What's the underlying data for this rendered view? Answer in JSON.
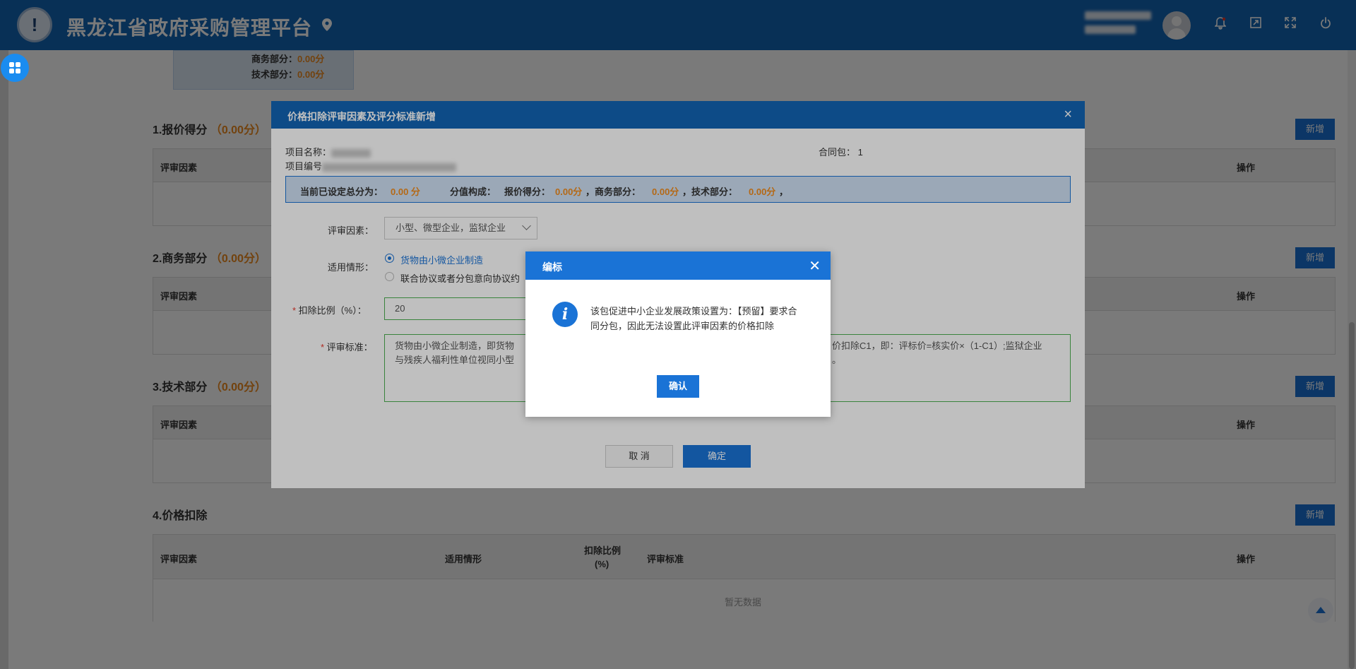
{
  "header": {
    "app_title": "黑龙江省政府采购管理平台",
    "icons": [
      "location-icon",
      "bell-icon",
      "window-icon",
      "fullscreen-icon",
      "power-icon"
    ]
  },
  "score_summary": {
    "business_label": "商务部分：",
    "business_value": "0.00分",
    "technical_label": "技术部分：",
    "technical_value": "0.00分"
  },
  "sections": [
    {
      "title": "1.报价得分",
      "score": "（0.00分）",
      "add_label": "新增",
      "columns": [
        "评审因素",
        "操作"
      ]
    },
    {
      "title": "2.商务部分",
      "score": "（0.00分）",
      "add_label": "新增",
      "columns": [
        "评审因素",
        "操作"
      ]
    },
    {
      "title": "3.技术部分",
      "score": "（0.00分）",
      "add_label": "新增",
      "columns": [
        "评审因素",
        "操作"
      ]
    },
    {
      "title": "4.价格扣除",
      "score": "",
      "add_label": "新增",
      "columns": [
        "评审因素",
        "适用情形",
        "扣除比例",
        "(%)",
        "评审标准",
        "操作"
      ],
      "empty_text": "暂无数据"
    }
  ],
  "dialog": {
    "title": "价格扣除评审因素及评分标准新增",
    "project_name_label": "项目名称：",
    "project_code_label": "项目编号",
    "contract_pkg_label": "合同包：",
    "contract_pkg_value": "1",
    "info_bar": {
      "total_label": "当前已设定总分为：",
      "total_value": "0.00 分",
      "composition_label": "分值构成：",
      "quote_label": "报价得分：",
      "quote_value": "0.00分",
      "business_label": "，商务部分：",
      "business_value": "0.00分",
      "technical_label": "，技术部分：",
      "technical_value": "0.00分",
      "tail": "，"
    },
    "factor_label": "评审因素：",
    "factor_value": "小型、微型企业，监狱企业",
    "scenario_label": "适用情形：",
    "scenario_options": [
      "货物由小微企业制造",
      "联合协议或者分包意向协议约"
    ],
    "deduction_label": "扣除比例（%）：",
    "deduction_value": "20",
    "standard_label": "评审标准：",
    "standard_text_line1_left": "货物由小微企业制造，即货物",
    "standard_text_line1_right": "价扣除C1，即：评标价=核实价×（1-C1）;监狱企业",
    "standard_text_line2_left": "与残疾人福利性单位视同小型",
    "standard_text_line2_right": "。",
    "cancel_label": "取 消",
    "confirm_label": "确定"
  },
  "alert": {
    "title": "编标",
    "message": "该包促进中小企业发展政策设置为：【预留】要求合同分包，因此无法设置此评审因素的价格扣除",
    "confirm_label": "确认"
  }
}
